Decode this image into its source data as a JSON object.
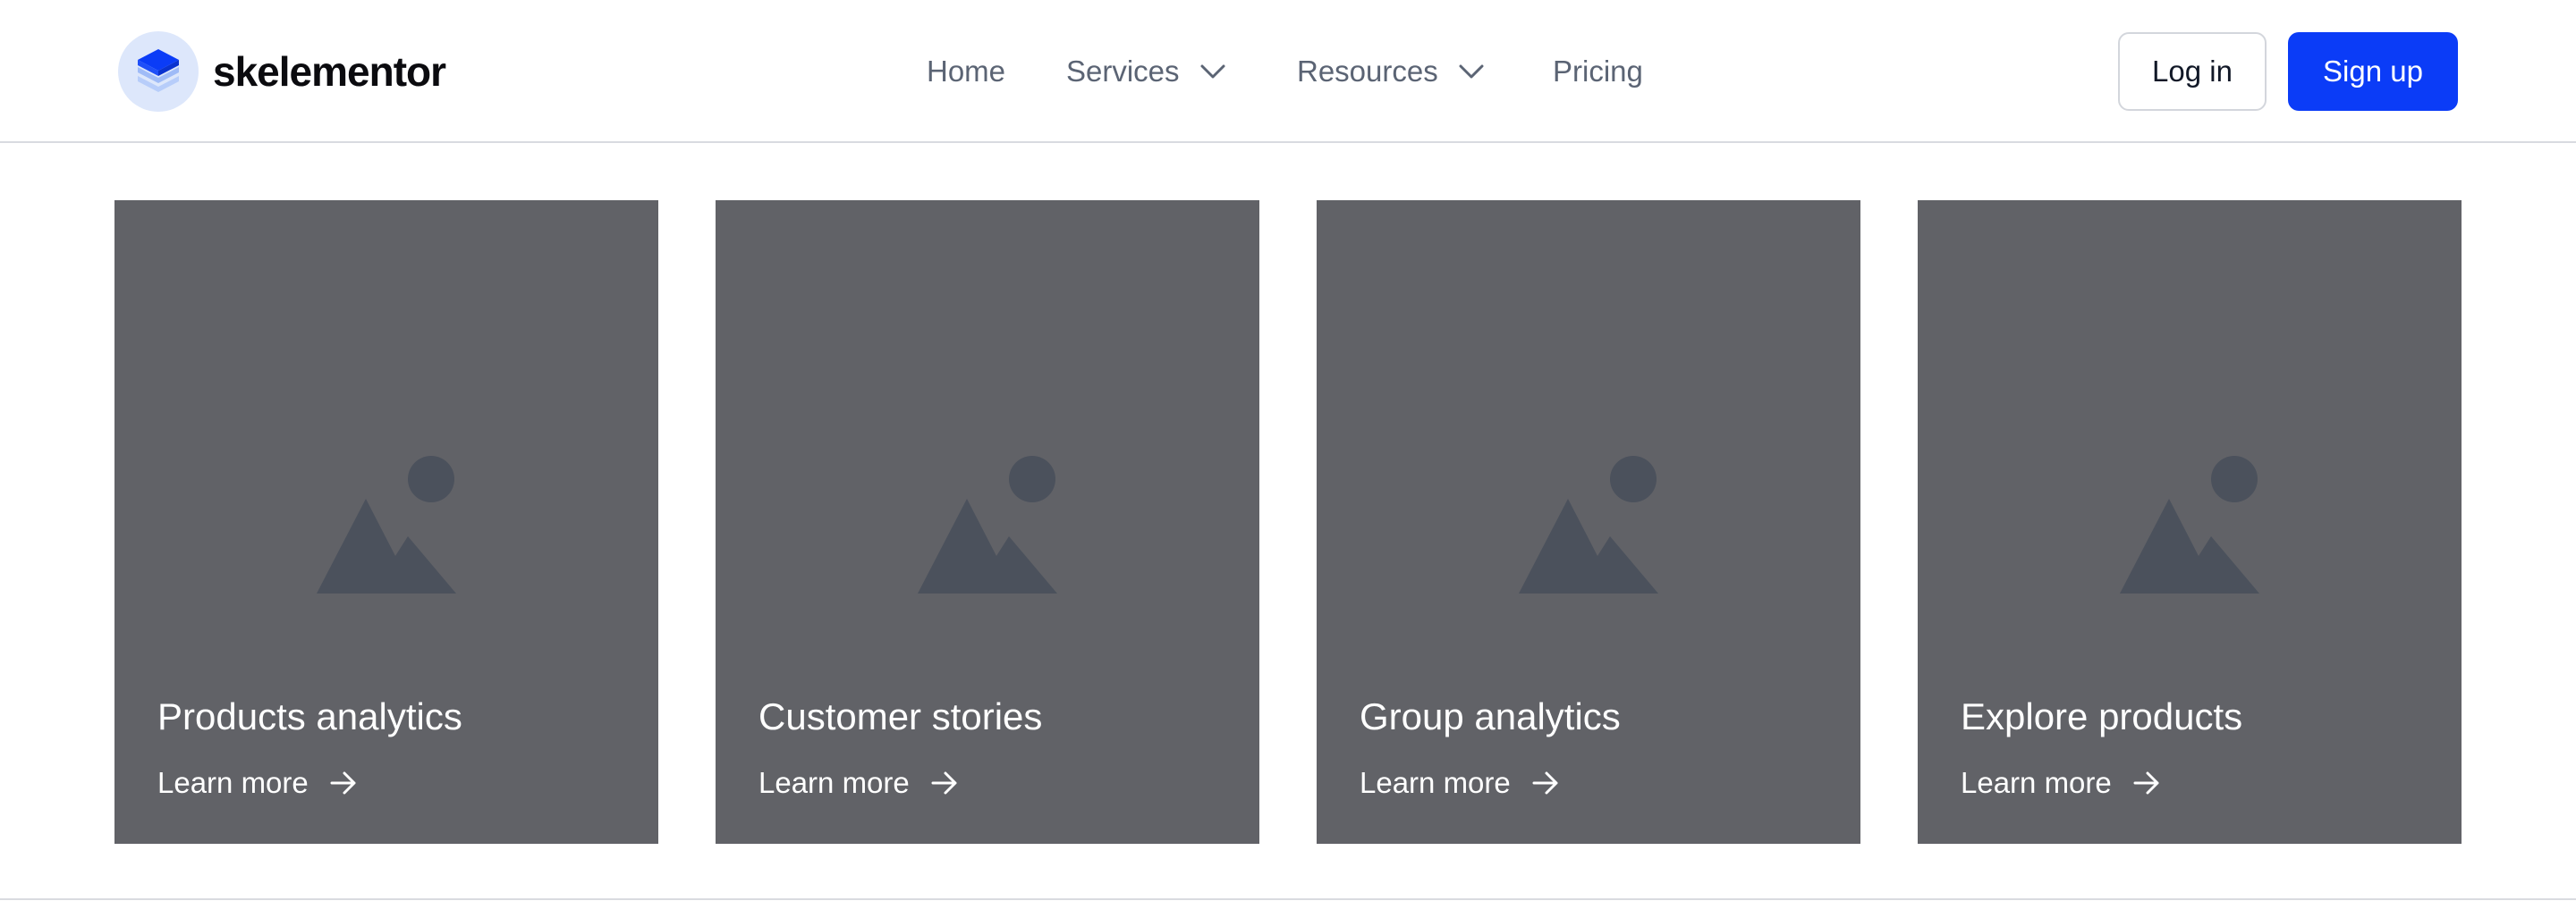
{
  "brand": {
    "name": "skelementor",
    "icon": "layers-icon",
    "accent": "#0b3cf7"
  },
  "nav": [
    {
      "label": "Home",
      "dropdown": false
    },
    {
      "label": "Services",
      "dropdown": true
    },
    {
      "label": "Resources",
      "dropdown": true
    },
    {
      "label": "Pricing",
      "dropdown": false
    }
  ],
  "auth": {
    "login_label": "Log in",
    "signup_label": "Sign up"
  },
  "cards": [
    {
      "title": "Products analytics",
      "link_label": "Learn more",
      "image_icon": "image-placeholder-icon"
    },
    {
      "title": "Customer stories",
      "link_label": "Learn more",
      "image_icon": "image-placeholder-icon"
    },
    {
      "title": "Group analytics",
      "link_label": "Learn more",
      "image_icon": "image-placeholder-icon"
    },
    {
      "title": "Explore products",
      "link_label": "Learn more",
      "image_icon": "image-placeholder-icon"
    }
  ],
  "colors": {
    "card_bg": "#616267",
    "placeholder_shape": "#4b515c",
    "nav_text": "#5b6474"
  }
}
